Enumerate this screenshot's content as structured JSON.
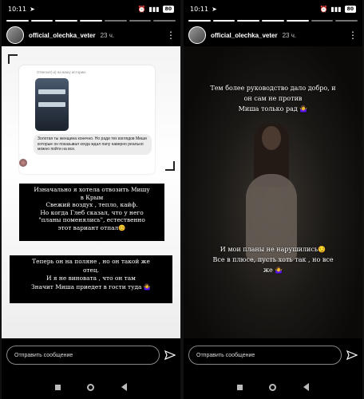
{
  "status": {
    "time": "10:11",
    "battery": "80"
  },
  "story": {
    "username": "official_olechka_veter",
    "time_left": "23 ч.",
    "time_right": "23 ч."
  },
  "left": {
    "dm_caption": "Ответил(-а) на вашу историю",
    "dm_message": "Золотая ты женщина конечно. Но ради тех взглядов Миши которые он показывал когда ждал папу наверно реально можно пойти на все.",
    "block1": [
      "Изначально я хотела отвозить Мишу",
      "в Крым",
      "Свежий воздух , тепло, кайф.",
      "Но когда Глеб сказал, что у него",
      "\"планы поменялись\", естественно",
      "этот вариант отпал😊"
    ],
    "block2": [
      "Теперь он на поляне , но он такой же",
      "отец.",
      "И я не виновата , что он там",
      "Значит Миша приедет в гости туда 🤷‍♀️"
    ]
  },
  "right": {
    "text1": [
      "Тем более руководство дало добро, и",
      "он сам не против",
      "Миша только рад 🤷‍♀️"
    ],
    "text2": [
      "И мои планы не нарушились😏",
      "Все в плюсе, пусть хоть так , но все",
      "же 🤷‍♀️"
    ]
  },
  "composer": {
    "placeholder": "Отправить сообщение"
  },
  "icons": [
    "send-icon",
    "more-dots-icon",
    "nav-back-icon",
    "nav-home-icon",
    "nav-recents-icon"
  ]
}
